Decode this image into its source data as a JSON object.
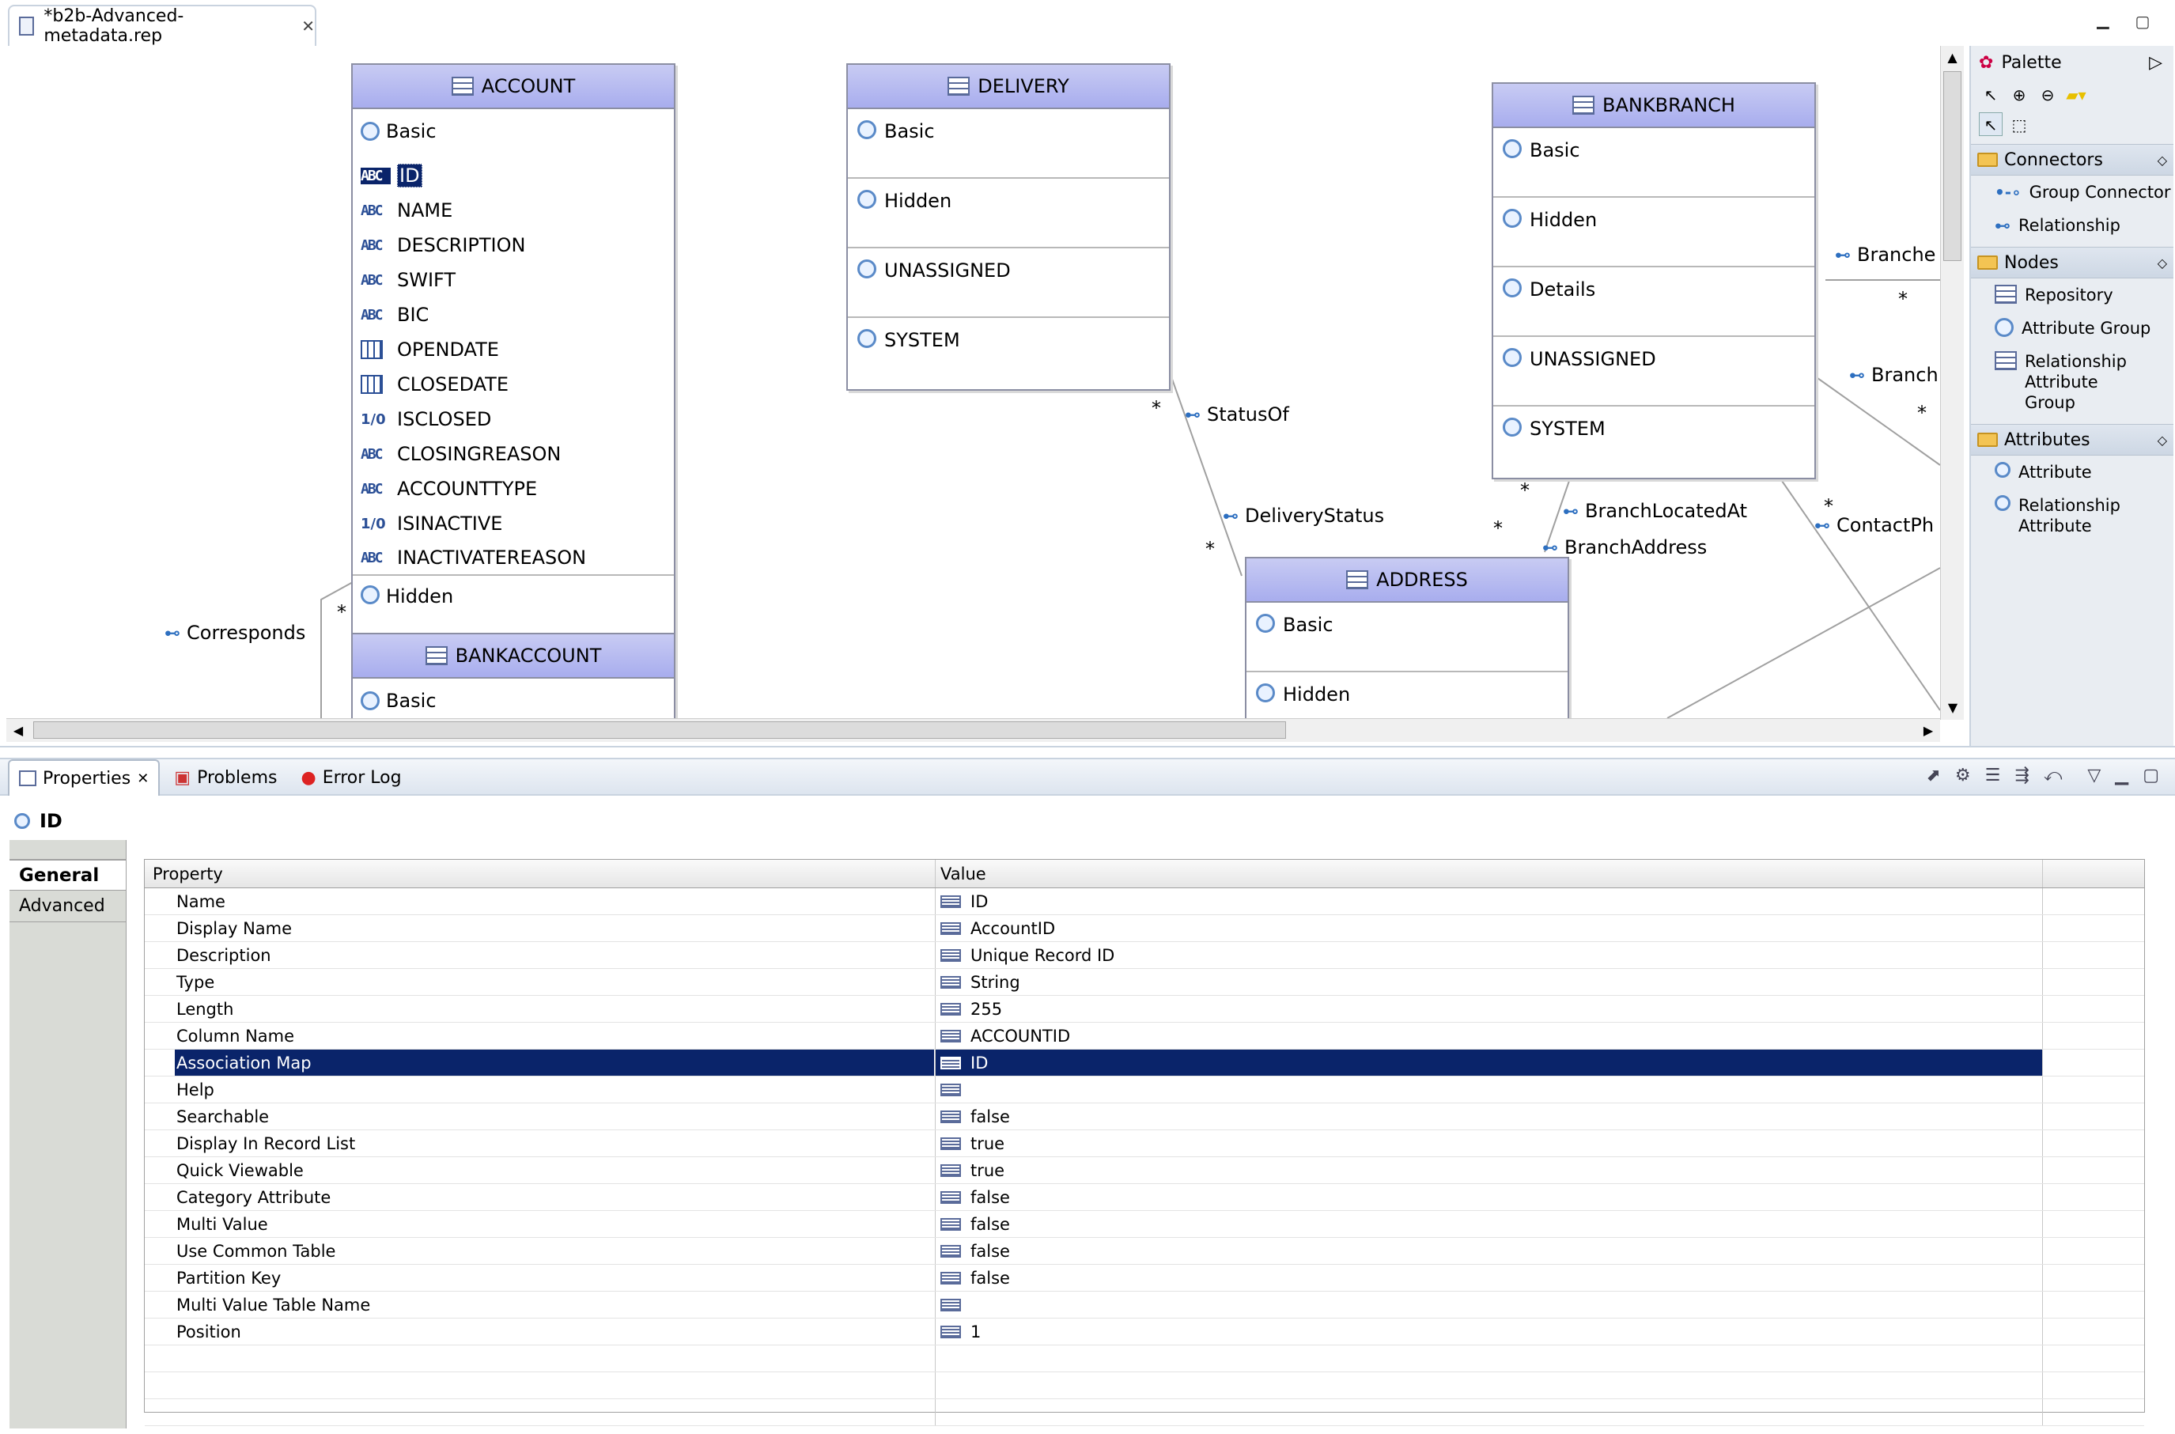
{
  "editor": {
    "tab_title": "*b2b-Advanced-metadata.rep"
  },
  "diagram": {
    "entities": {
      "account": {
        "title": "ACCOUNT",
        "group_basic": "Basic",
        "attributes": [
          {
            "label": "ID",
            "type": "abc"
          },
          {
            "label": "NAME",
            "type": "abc"
          },
          {
            "label": "DESCRIPTION",
            "type": "abc"
          },
          {
            "label": "SWIFT",
            "type": "abc"
          },
          {
            "label": "BIC",
            "type": "abc"
          },
          {
            "label": "OPENDATE",
            "type": "date"
          },
          {
            "label": "CLOSEDATE",
            "type": "date"
          },
          {
            "label": "ISCLOSED",
            "type": "bool"
          },
          {
            "label": "CLOSINGREASON",
            "type": "abc"
          },
          {
            "label": "ACCOUNTTYPE",
            "type": "abc"
          },
          {
            "label": "ISINACTIVE",
            "type": "bool"
          },
          {
            "label": "INACTIVATEREASON",
            "type": "abc"
          }
        ],
        "group_hidden": "Hidden"
      },
      "bankaccount": {
        "title": "BANKACCOUNT",
        "group_basic": "Basic"
      },
      "delivery": {
        "title": "DELIVERY",
        "groups": [
          "Basic",
          "Hidden",
          "UNASSIGNED",
          "SYSTEM"
        ]
      },
      "bankbranch": {
        "title": "BANKBRANCH",
        "groups": [
          "Basic",
          "Hidden",
          "Details",
          "UNASSIGNED",
          "SYSTEM"
        ]
      },
      "address": {
        "title": "ADDRESS",
        "groups": [
          "Basic",
          "Hidden"
        ]
      }
    },
    "connectors": {
      "corresponds": "Corresponds",
      "status_of": "StatusOf",
      "delivery_status": "DeliveryStatus",
      "branch_located_at": "BranchLocatedAt",
      "branch_address": "BranchAddress",
      "branche": "Branche",
      "branch": "Branch",
      "contact_ph": "ContactPh"
    },
    "multiplicity": "*"
  },
  "palette": {
    "title": "Palette",
    "sections": {
      "connectors": {
        "label": "Connectors",
        "items": [
          "Group Connector",
          "Relationship"
        ]
      },
      "nodes": {
        "label": "Nodes",
        "items": [
          "Repository",
          "Attribute Group",
          "Relationship Attribute Group"
        ]
      },
      "attributes": {
        "label": "Attributes",
        "items": [
          "Attribute",
          "Relationship Attribute"
        ]
      }
    }
  },
  "views": {
    "tabs": {
      "properties": "Properties",
      "problems": "Problems",
      "error_log": "Error Log"
    },
    "selection_title": "ID",
    "side_tabs": {
      "general": "General",
      "advanced": "Advanced"
    },
    "table": {
      "header_property": "Property",
      "header_value": "Value",
      "rows": [
        {
          "property": "Name",
          "value": "ID"
        },
        {
          "property": "Display Name",
          "value": "AccountID"
        },
        {
          "property": "Description",
          "value": "Unique Record ID"
        },
        {
          "property": "Type",
          "value": "String"
        },
        {
          "property": "Length",
          "value": "255"
        },
        {
          "property": "Column Name",
          "value": "ACCOUNTID"
        },
        {
          "property": "Association Map",
          "value": "ID"
        },
        {
          "property": "Help",
          "value": ""
        },
        {
          "property": "Searchable",
          "value": "false"
        },
        {
          "property": "Display In Record List",
          "value": "true"
        },
        {
          "property": "Quick Viewable",
          "value": "true"
        },
        {
          "property": "Category Attribute",
          "value": "false"
        },
        {
          "property": "Multi Value",
          "value": "false"
        },
        {
          "property": "Use Common Table",
          "value": "false"
        },
        {
          "property": "Partition Key",
          "value": "false"
        },
        {
          "property": "Multi Value Table Name",
          "value": ""
        },
        {
          "property": "Position",
          "value": "1"
        }
      ]
    }
  }
}
